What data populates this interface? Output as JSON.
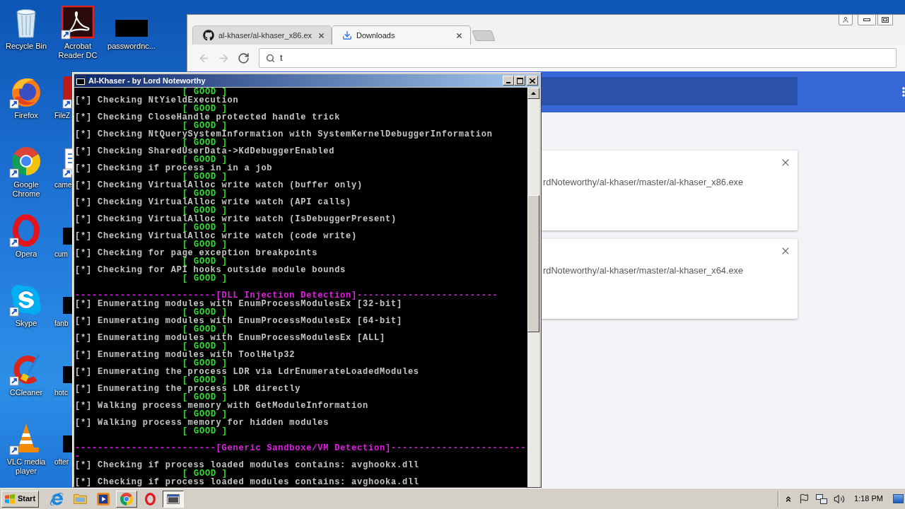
{
  "desktop": {
    "icons": [
      {
        "kind": "recycle-bin",
        "label": "Recycle Bin",
        "shortcut": false,
        "covered": false
      },
      {
        "kind": "firefox",
        "label": "Firefox",
        "shortcut": true,
        "covered": false
      },
      {
        "kind": "chrome",
        "label": "Google Chrome",
        "shortcut": true,
        "covered": false
      },
      {
        "kind": "opera",
        "label": "Opera",
        "shortcut": true,
        "covered": false
      },
      {
        "kind": "skype",
        "label": "Skype",
        "shortcut": true,
        "covered": false
      },
      {
        "kind": "ccleaner",
        "label": "CCleaner",
        "shortcut": true,
        "covered": false
      },
      {
        "kind": "vlc",
        "label": "VLC media player",
        "shortcut": true,
        "covered": false
      },
      {
        "kind": "acrobat",
        "label": "Acrobat Reader DC",
        "shortcut": true,
        "covered": false
      },
      {
        "kind": "filezilla",
        "label": "FileZ",
        "shortcut": true,
        "covered": true
      },
      {
        "kind": "document",
        "label": "came",
        "shortcut": true,
        "covered": true
      },
      {
        "kind": "thumbnail",
        "label": "cum",
        "shortcut": false,
        "covered": true
      },
      {
        "kind": "thumbnail",
        "label": "fanb",
        "shortcut": false,
        "covered": true
      },
      {
        "kind": "thumbnail",
        "label": "hotc",
        "shortcut": false,
        "covered": true
      },
      {
        "kind": "thumbnail",
        "label": "ofter",
        "shortcut": false,
        "covered": true
      },
      {
        "kind": "thumbnail",
        "label": "passwordnc...",
        "shortcut": false,
        "covered": false
      }
    ]
  },
  "browser": {
    "tabs": [
      {
        "kind": "github",
        "title": "al-khaser/al-khaser_x86.ex",
        "selected": false
      },
      {
        "kind": "download",
        "title": "Downloads",
        "selected": true
      }
    ],
    "toolbar": [
      {
        "kind": "back",
        "disabled": true
      },
      {
        "kind": "forward",
        "disabled": true
      },
      {
        "kind": "reload",
        "disabled": false
      }
    ],
    "address_bar": {
      "value": "t"
    },
    "downloads": [
      {
        "url": "rdNoteworthy/al-khaser/master/al-khaser_x86.exe"
      },
      {
        "url": "rdNoteworthy/al-khaser/master/al-khaser_x64.exe"
      }
    ]
  },
  "console": {
    "title": "Al-Khaser - by Lord Noteworthy",
    "lines": [
      {
        "kind": "result",
        "text": "[ GOOD ]"
      },
      {
        "kind": "check",
        "text": "[*] Checking NtYieldExecution"
      },
      {
        "kind": "result",
        "text": "[ GOOD ]"
      },
      {
        "kind": "check",
        "text": "[*] Checking CloseHandle protected handle trick"
      },
      {
        "kind": "result",
        "text": "[ GOOD ]"
      },
      {
        "kind": "check",
        "text": "[*] Checking NtQuerySystemInformation with SystemKernelDebuggerInformation"
      },
      {
        "kind": "result",
        "text": "[ GOOD ]"
      },
      {
        "kind": "check",
        "text": "[*] Checking SharedUserData->KdDebuggerEnabled"
      },
      {
        "kind": "result",
        "text": "[ GOOD ]"
      },
      {
        "kind": "check",
        "text": "[*] Checking if process in in a job"
      },
      {
        "kind": "result",
        "text": "[ GOOD ]"
      },
      {
        "kind": "check",
        "text": "[*] Checking VirtualAlloc write watch (buffer only)"
      },
      {
        "kind": "result",
        "text": "[ GOOD ]"
      },
      {
        "kind": "check",
        "text": "[*] Checking VirtualAlloc write watch (API calls)"
      },
      {
        "kind": "result",
        "text": "[ GOOD ]"
      },
      {
        "kind": "check",
        "text": "[*] Checking VirtualAlloc write watch (IsDebuggerPresent)"
      },
      {
        "kind": "result",
        "text": "[ GOOD ]"
      },
      {
        "kind": "check",
        "text": "[*] Checking VirtualAlloc write watch (code write)"
      },
      {
        "kind": "result",
        "text": "[ GOOD ]"
      },
      {
        "kind": "check",
        "text": "[*] Checking for page exception breakpoints"
      },
      {
        "kind": "result",
        "text": "[ GOOD ]"
      },
      {
        "kind": "check",
        "text": "[*] Checking for API hooks outside module bounds"
      },
      {
        "kind": "result",
        "text": "[ GOOD ]"
      },
      {
        "kind": "blank"
      },
      {
        "kind": "heading",
        "text": "-------------------------[DLL Injection Detection]-------------------------"
      },
      {
        "kind": "check",
        "text": "[*] Enumerating modules with EnumProcessModulesEx [32-bit]"
      },
      {
        "kind": "result",
        "text": "[ GOOD ]"
      },
      {
        "kind": "check",
        "text": "[*] Enumerating modules with EnumProcessModulesEx [64-bit]"
      },
      {
        "kind": "result",
        "text": "[ GOOD ]"
      },
      {
        "kind": "check",
        "text": "[*] Enumerating modules with EnumProcessModulesEx [ALL]"
      },
      {
        "kind": "result",
        "text": "[ GOOD ]"
      },
      {
        "kind": "check",
        "text": "[*] Enumerating modules with ToolHelp32"
      },
      {
        "kind": "result",
        "text": "[ GOOD ]"
      },
      {
        "kind": "check",
        "text": "[*] Enumerating the process LDR via LdrEnumerateLoadedModules"
      },
      {
        "kind": "result",
        "text": "[ GOOD ]"
      },
      {
        "kind": "check",
        "text": "[*] Enumerating the process LDR directly"
      },
      {
        "kind": "result",
        "text": "[ GOOD ]"
      },
      {
        "kind": "check",
        "text": "[*] Walking process memory with GetModuleInformation"
      },
      {
        "kind": "result",
        "text": "[ GOOD ]"
      },
      {
        "kind": "check",
        "text": "[*] Walking process memory for hidden modules"
      },
      {
        "kind": "result",
        "text": "[ GOOD ]"
      },
      {
        "kind": "blank"
      },
      {
        "kind": "heading",
        "text": "-------------------------[Generic Sandboxe/VM Detection]------------------------"
      },
      {
        "kind": "heading",
        "text": "-"
      },
      {
        "kind": "check",
        "text": "[*] Checking if process loaded modules contains: avghookx.dll"
      },
      {
        "kind": "result",
        "text": "[ GOOD ]"
      },
      {
        "kind": "check",
        "text": "[*] Checking if process loaded modules contains: avghooka.dll"
      }
    ]
  },
  "taskbar": {
    "start_button": "Start",
    "buttons": [
      {
        "kind": "ie",
        "selected": false,
        "running": false
      },
      {
        "kind": "folder",
        "selected": false,
        "running": false
      },
      {
        "kind": "media-player",
        "selected": false,
        "running": false
      },
      {
        "kind": "chrome",
        "selected": false,
        "running": true
      },
      {
        "kind": "opera",
        "selected": false,
        "running": false
      },
      {
        "kind": "console",
        "selected": true,
        "running": true
      }
    ],
    "tray": [
      {
        "kind": "chevron"
      },
      {
        "kind": "flag"
      },
      {
        "kind": "network"
      },
      {
        "kind": "volume"
      }
    ],
    "clock": "1:18 PM"
  }
}
